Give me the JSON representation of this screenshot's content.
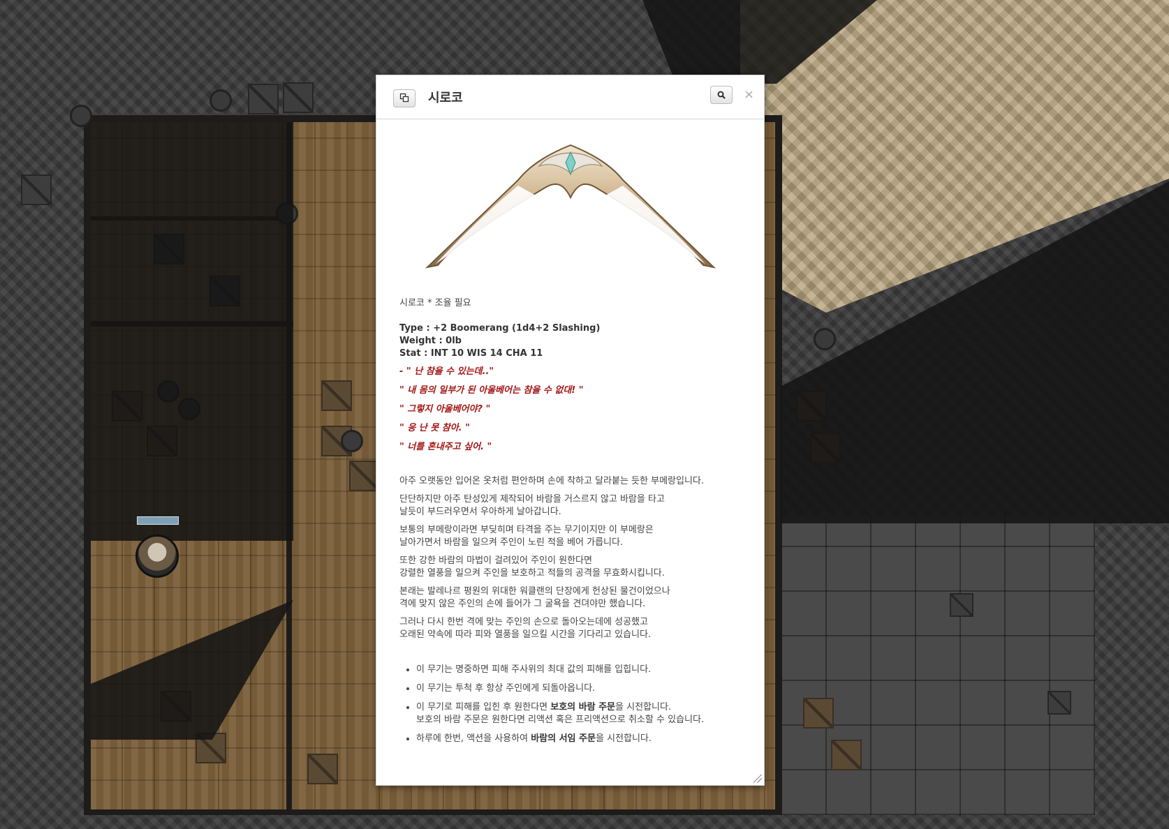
{
  "dialog": {
    "title": "시로코",
    "close_symbol": "×",
    "icons": {
      "popout": "popout-icon",
      "zoom": "magnifier-icon",
      "image": "boomerang-image"
    }
  },
  "item": {
    "name_line": "시로코 * 조율 필요",
    "type_line": "Type : +2 Boomerang (1d4+2 Slashing)",
    "weight_line": "Weight : 0lb",
    "stat_line": "Stat : INT 10 WIS 14 CHA 11",
    "quotes": [
      "- \" 난 참을 수 있는데..\"",
      "\" 내 몸의 일부가 된 아울베어는 참을 수 없대! \"",
      "\" 그렇지 아울베어야? \"",
      "\" 응 난 못 참아. \"",
      "\" 너를 혼내주고 싶어. \""
    ],
    "paragraphs": [
      [
        "아주 오랫동안 입어온 옷처럼 편안하며 손에 착하고 달라붙는 듯한 부메랑입니다."
      ],
      [
        "단단하지만 아주 탄성있게 제작되어 바람을 거스르지 않고 바람을 타고",
        "날듯이 부드러우면서 우아하게 날아갑니다."
      ],
      [
        "보통의 부메랑이라면 부딪히며 타격을 주는 무기이지만 이 부메랑은",
        "날아가면서 바람을 일으켜 주인이 노린 적을 베어 가릅니다."
      ],
      [
        "또한 강한 바람의 마법이 걸려있어 주인이 원한다면",
        "강렬한 열풍을 일으켜 주인을 보호하고 적들의 공격을 무효화시킵니다."
      ],
      [
        "본래는 발레나르 평원의 위대한 워클랜의 단장에게 헌상된 물건이었으나",
        "격에 맞지 않은 주인의 손에 들어가 그 굴욕을 견뎌야만 했습니다."
      ],
      [
        "그러나 다시 한번 격에 맞는 주인의 손으로 돌아오는데에 성공했고",
        "오래된 약속에 따라 피와 열풍을 일으킬 시간을 기다리고 있습니다."
      ]
    ],
    "features": {
      "f1": "이 무기는 명중하면 피해 주사위의 최대 값의 피해를 입힙니다.",
      "f2": "이 무기는 투척 후 항상 주인에게 되돌아옵니다.",
      "f3_pre": "이 무기로 피해를 입힌 후 원한다면 ",
      "f3_bold": "보호의 바람 주문",
      "f3_post": "을 시전합니다.",
      "f3_line2": "보호의 바람 주문은 원한다면 리액션 혹은 프리액션으로 취소할 수 있습니다.",
      "f4_pre": "하루에 한번, 액션을 사용하여 ",
      "f4_bold": "바람의 서임 주문",
      "f4_post": "을 시전합니다."
    }
  },
  "map": {
    "token_name": "token-avatar"
  },
  "colors": {
    "quote_red": "#a51717",
    "floor_wood": "#7a5f3a",
    "dialog_bg": "#ffffff"
  }
}
